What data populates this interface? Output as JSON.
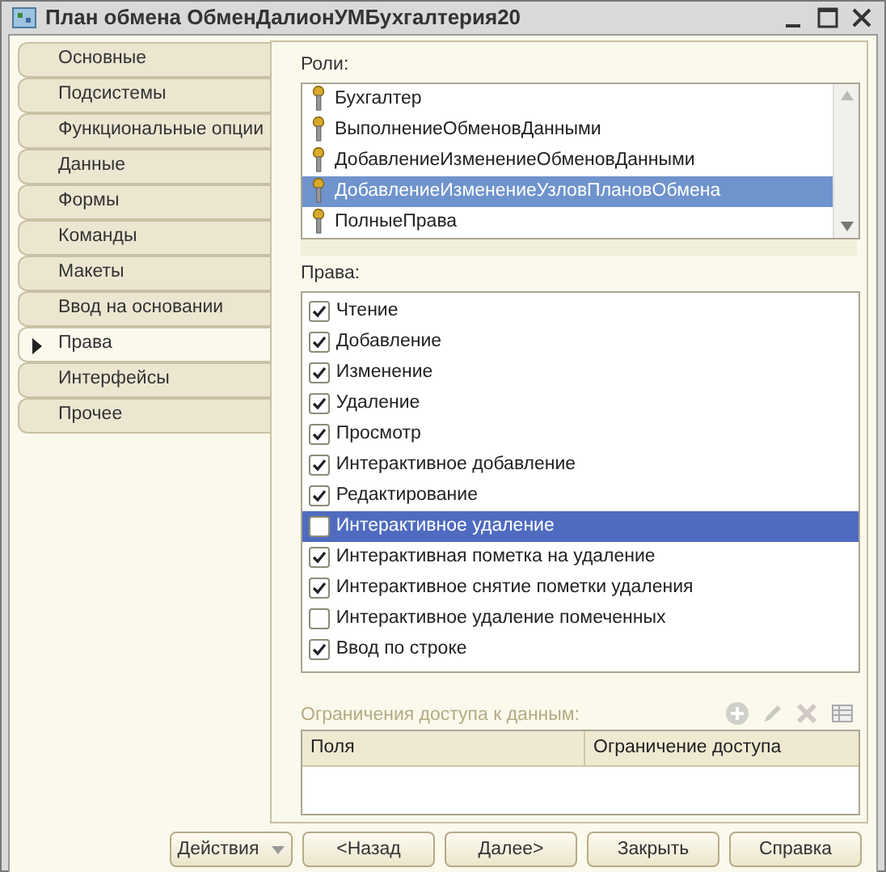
{
  "window": {
    "title": "План обмена ОбменДалионУМБухгалтерия20"
  },
  "tabs": [
    {
      "label": "Основные",
      "selected": false
    },
    {
      "label": "Подсистемы",
      "selected": false
    },
    {
      "label": "Функциональные опции",
      "selected": false
    },
    {
      "label": "Данные",
      "selected": false
    },
    {
      "label": "Формы",
      "selected": false
    },
    {
      "label": "Команды",
      "selected": false
    },
    {
      "label": "Макеты",
      "selected": false
    },
    {
      "label": "Ввод на основании",
      "selected": false
    },
    {
      "label": "Права",
      "selected": true
    },
    {
      "label": "Интерфейсы",
      "selected": false
    },
    {
      "label": "Прочее",
      "selected": false
    }
  ],
  "roles": {
    "label": "Роли:",
    "items": [
      {
        "name": "Бухгалтер",
        "selected": false
      },
      {
        "name": "ВыполнениеОбменовДанными",
        "selected": false
      },
      {
        "name": "ДобавлениеИзменениеОбменовДанными",
        "selected": false
      },
      {
        "name": "ДобавлениеИзменениеУзловПлановОбмена",
        "selected": true
      },
      {
        "name": "ПолныеПрава",
        "selected": false
      }
    ]
  },
  "rights": {
    "label": "Права:",
    "items": [
      {
        "name": "Чтение",
        "checked": true,
        "selected": false
      },
      {
        "name": "Добавление",
        "checked": true,
        "selected": false
      },
      {
        "name": "Изменение",
        "checked": true,
        "selected": false
      },
      {
        "name": "Удаление",
        "checked": true,
        "selected": false
      },
      {
        "name": "Просмотр",
        "checked": true,
        "selected": false
      },
      {
        "name": "Интерактивное добавление",
        "checked": true,
        "selected": false
      },
      {
        "name": "Редактирование",
        "checked": true,
        "selected": false
      },
      {
        "name": "Интерактивное удаление",
        "checked": false,
        "selected": true
      },
      {
        "name": "Интерактивная пометка на удаление",
        "checked": true,
        "selected": false
      },
      {
        "name": "Интерактивное снятие пометки удаления",
        "checked": true,
        "selected": false
      },
      {
        "name": "Интерактивное удаление помеченных",
        "checked": false,
        "selected": false
      },
      {
        "name": "Ввод по строке",
        "checked": true,
        "selected": false
      }
    ]
  },
  "restrictions": {
    "label": "Ограничения доступа к данным:",
    "columns": [
      "Поля",
      "Ограничение доступа"
    ]
  },
  "buttons": [
    {
      "label": "Действия",
      "kind": "menu"
    },
    {
      "label": "<Назад",
      "kind": "plain"
    },
    {
      "label": "Далее>",
      "kind": "plain"
    },
    {
      "label": "Закрыть",
      "kind": "plain"
    },
    {
      "label": "Справка",
      "kind": "plain"
    }
  ]
}
